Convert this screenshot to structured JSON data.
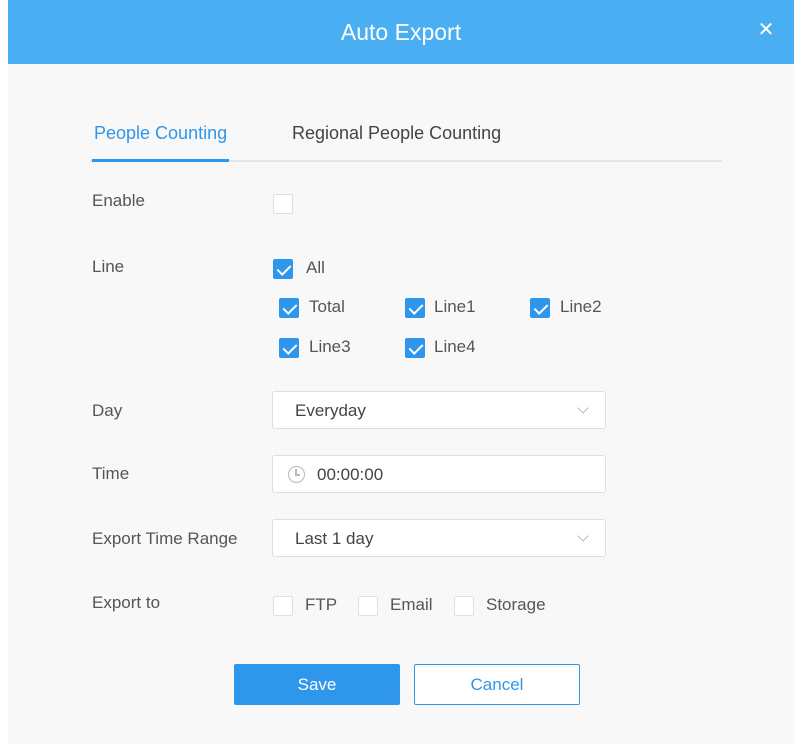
{
  "dialog": {
    "title": "Auto Export",
    "close_glyph": "✕"
  },
  "tabs": [
    {
      "label": "People Counting",
      "active": true
    },
    {
      "label": "Regional People Counting",
      "active": false
    }
  ],
  "enable": {
    "label": "Enable",
    "checked": false
  },
  "line": {
    "label": "Line",
    "all": {
      "label": "All",
      "checked": true
    },
    "options": [
      {
        "label": "Total",
        "checked": true
      },
      {
        "label": "Line1",
        "checked": true
      },
      {
        "label": "Line2",
        "checked": true
      },
      {
        "label": "Line3",
        "checked": true
      },
      {
        "label": "Line4",
        "checked": true
      }
    ]
  },
  "day": {
    "label": "Day",
    "value": "Everyday"
  },
  "time": {
    "label": "Time",
    "value": "00:00:00"
  },
  "export_time_range": {
    "label": "Export Time Range",
    "value": "Last 1 day"
  },
  "export_to": {
    "label": "Export to",
    "options": [
      {
        "label": "FTP",
        "checked": false
      },
      {
        "label": "Email",
        "checked": false
      },
      {
        "label": "Storage",
        "checked": false
      }
    ]
  },
  "buttons": {
    "save": "Save",
    "cancel": "Cancel"
  },
  "colors": {
    "header": "#4aaef3",
    "accent": "#2f97eb",
    "background": "#f8f8f8"
  },
  "icons": {
    "close": "close-icon",
    "clock": "clock-icon",
    "dropdown": "chevron-down-icon",
    "check": "checkmark-icon"
  }
}
